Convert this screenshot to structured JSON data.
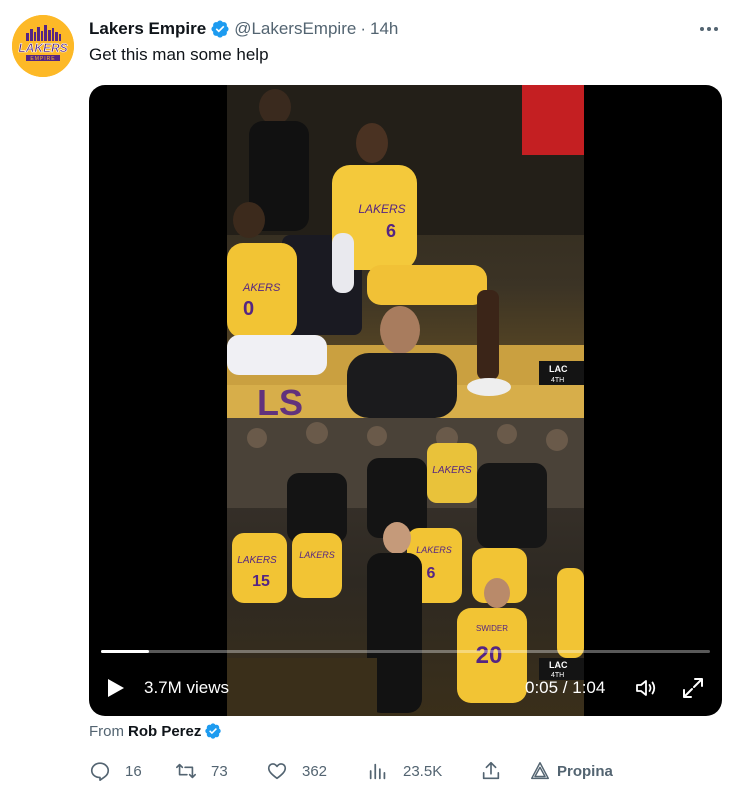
{
  "tweet": {
    "display_name": "Lakers Empire",
    "handle": "@LakersEmpire",
    "separator": "·",
    "time": "14h",
    "text": "Get this man some help",
    "avatar": {
      "icon": "lakers-empire-logo",
      "logo_text": "LAKERS",
      "logo_subtext": "EMPIRE"
    }
  },
  "video": {
    "views": "3.7M views",
    "time_readout": "0:05 / 1:04",
    "progress": 0.078,
    "scoreboard_top": {
      "team": "LAC",
      "period": "4TH"
    },
    "scoreboard_bottom": {
      "team": "LAC",
      "period": "4TH"
    },
    "jersey_numbers": [
      "6",
      "0",
      "15",
      "6",
      "20"
    ],
    "jersey_text": [
      "LAKERS",
      "SWIDER"
    ]
  },
  "source": {
    "from_label": "From",
    "author": "Rob Perez"
  },
  "actions": {
    "replies": "16",
    "retweets": "73",
    "likes": "362",
    "views": "23.5K",
    "tip_label": "Propina"
  },
  "colors": {
    "verified": "#1d9bf0",
    "text_secondary": "#536471",
    "lakers_gold": "#fdb927",
    "lakers_purple": "#552583"
  }
}
